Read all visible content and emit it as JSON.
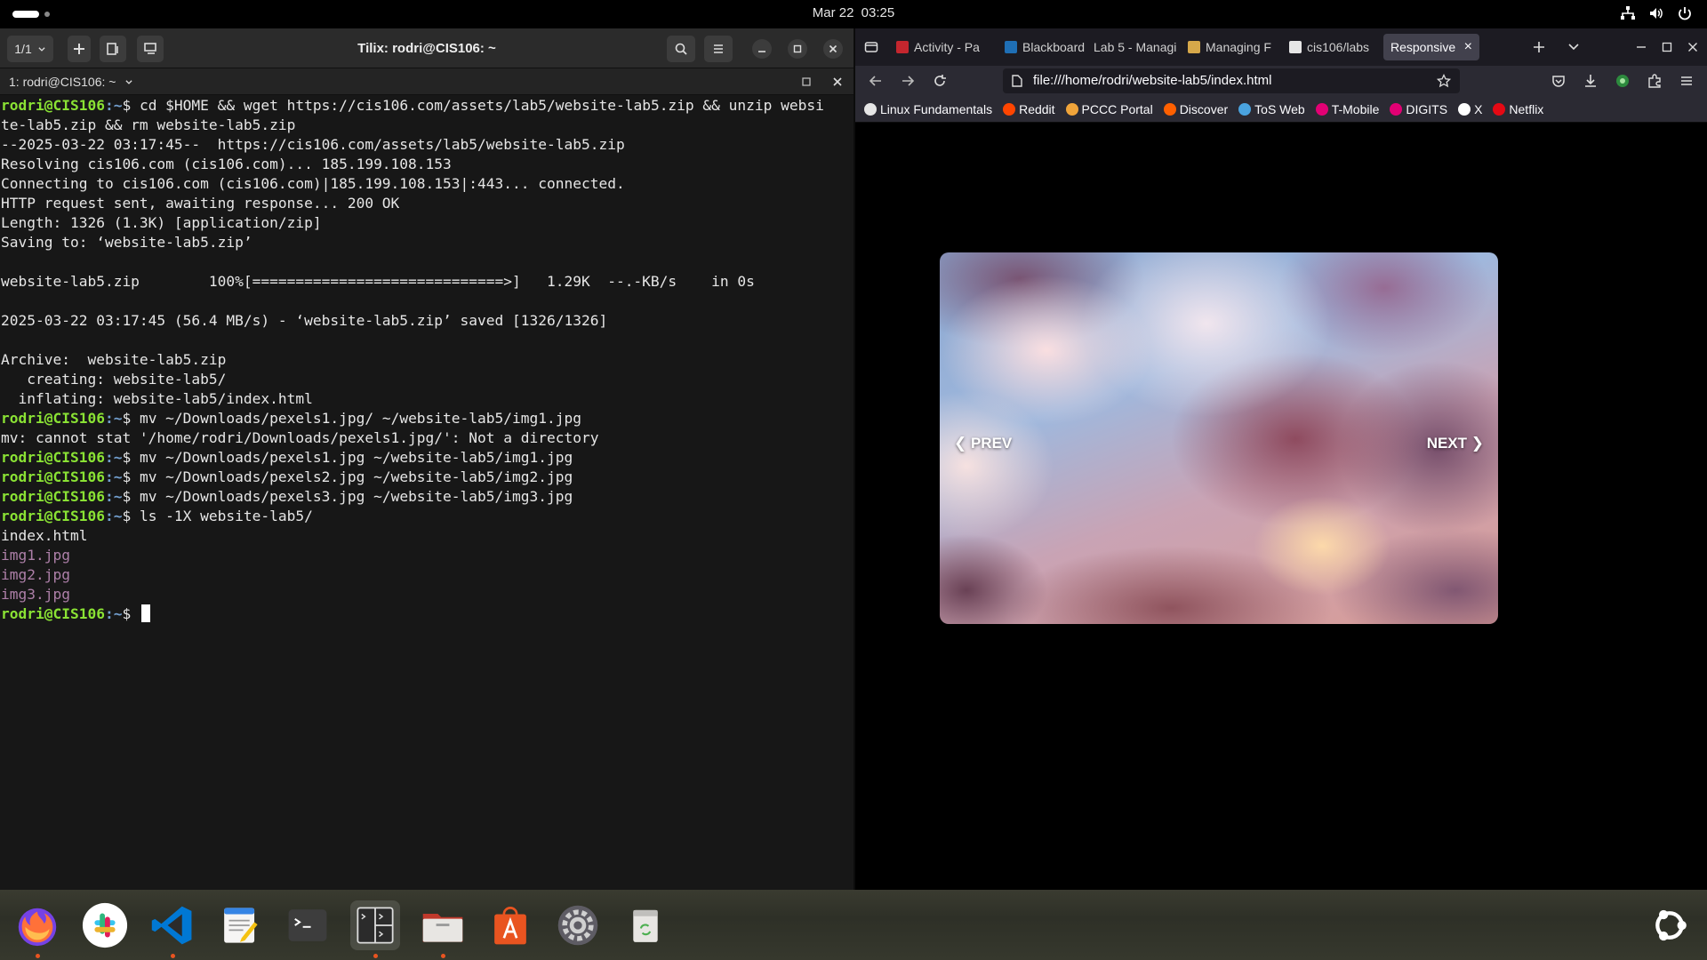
{
  "topbar": {
    "date": "Mar 22",
    "time": "03:25"
  },
  "tilix": {
    "tab_counter": "1/1",
    "title": "Tilix: rodri@CIS106: ~",
    "session_label": "1: rodri@CIS106: ~",
    "prompt_user": "rodri@CIS106",
    "prompt_path": ":~",
    "prompt_symbol": "$",
    "lines": [
      {
        "prompt": true,
        "cmd": " cd $HOME && wget https://cis106.com/assets/lab5/website-lab5.zip && unzip websi"
      },
      {
        "text": "te-lab5.zip && rm website-lab5.zip"
      },
      {
        "text": "--2025-03-22 03:17:45--  https://cis106.com/assets/lab5/website-lab5.zip"
      },
      {
        "text": "Resolving cis106.com (cis106.com)... 185.199.108.153"
      },
      {
        "text": "Connecting to cis106.com (cis106.com)|185.199.108.153|:443... connected."
      },
      {
        "text": "HTTP request sent, awaiting response... 200 OK"
      },
      {
        "text": "Length: 1326 (1.3K) [application/zip]"
      },
      {
        "text": "Saving to: ‘website-lab5.zip’"
      },
      {
        "text": ""
      },
      {
        "text": "website-lab5.zip        100%[=============================>]   1.29K  --.-KB/s    in 0s"
      },
      {
        "text": ""
      },
      {
        "text": "2025-03-22 03:17:45 (56.4 MB/s) - ‘website-lab5.zip’ saved [1326/1326]"
      },
      {
        "text": ""
      },
      {
        "text": "Archive:  website-lab5.zip"
      },
      {
        "text": "   creating: website-lab5/"
      },
      {
        "text": "  inflating: website-lab5/index.html"
      },
      {
        "prompt": true,
        "cmd": " mv ~/Downloads/pexels1.jpg/ ~/website-lab5/img1.jpg"
      },
      {
        "text": "mv: cannot stat '/home/rodri/Downloads/pexels1.jpg/': Not a directory"
      },
      {
        "prompt": true,
        "cmd": " mv ~/Downloads/pexels1.jpg ~/website-lab5/img1.jpg"
      },
      {
        "prompt": true,
        "cmd": " mv ~/Downloads/pexels2.jpg ~/website-lab5/img2.jpg"
      },
      {
        "prompt": true,
        "cmd": " mv ~/Downloads/pexels3.jpg ~/website-lab5/img3.jpg"
      },
      {
        "prompt": true,
        "cmd": " ls -1X website-lab5/"
      },
      {
        "text": "index.html"
      },
      {
        "text": "img1.jpg",
        "img": true
      },
      {
        "text": "img2.jpg",
        "img": true
      },
      {
        "text": "img3.jpg",
        "img": true
      },
      {
        "prompt": true,
        "cmd": " ",
        "cursor": true
      }
    ]
  },
  "firefox": {
    "tabs": [
      {
        "label": "Activity - Pa",
        "color": "#c4262e"
      },
      {
        "label": "Blackboard",
        "color": "#1f6fb5"
      },
      {
        "label": "Lab 5 - Managi",
        "color": ""
      },
      {
        "label": "Managing F",
        "color": "#d6a84a"
      },
      {
        "label": "cis106/labs",
        "color": "#e6e6e6"
      },
      {
        "label": "Responsive",
        "color": "",
        "active": true
      }
    ],
    "url": "file:///home/rodri/website-lab5/index.html",
    "bookmarks": [
      {
        "label": "Linux Fundamentals",
        "color": "#e6e6e6"
      },
      {
        "label": "Reddit",
        "color": "#ff4500"
      },
      {
        "label": "PCCC Portal",
        "color": "#f0a43a"
      },
      {
        "label": "Discover",
        "color": "#ff6000"
      },
      {
        "label": "ToS Web",
        "color": "#4aa3df"
      },
      {
        "label": "T-Mobile",
        "color": "#e20074"
      },
      {
        "label": "DIGITS",
        "color": "#e20074"
      },
      {
        "label": "X",
        "color": "#ffffff"
      },
      {
        "label": "Netflix",
        "color": "#e50914"
      }
    ],
    "slider": {
      "prev": "❮ PREV",
      "next": "NEXT ❯"
    }
  },
  "dock": {
    "apps": [
      "firefox-icon",
      "slack-icon",
      "vscode-icon",
      "text-editor-icon",
      "terminal-icon",
      "tilix-icon",
      "files-icon",
      "app-center-icon",
      "settings-icon",
      "trash-icon"
    ]
  }
}
